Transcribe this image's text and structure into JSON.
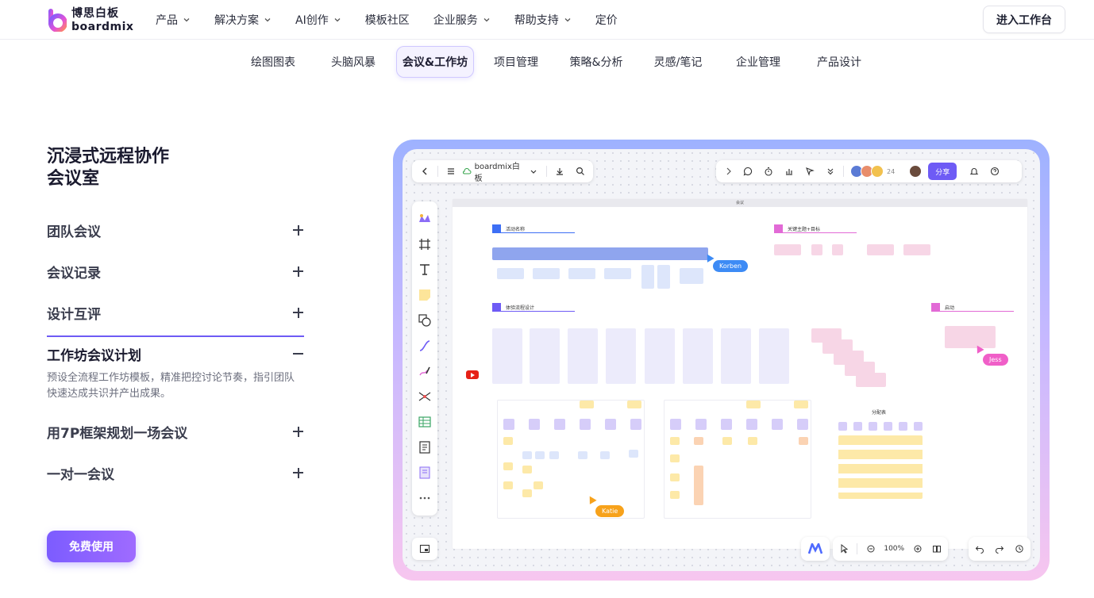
{
  "nav": {
    "logo_cn": "博思白板",
    "logo_en": "boardmix",
    "menu": [
      {
        "label": "产品",
        "has_dropdown": true
      },
      {
        "label": "解决方案",
        "has_dropdown": true
      },
      {
        "label": "AI创作",
        "has_dropdown": true
      },
      {
        "label": "模板社区",
        "has_dropdown": false
      },
      {
        "label": "企业服务",
        "has_dropdown": true
      },
      {
        "label": "帮助支持",
        "has_dropdown": true
      },
      {
        "label": "定价",
        "has_dropdown": false
      }
    ],
    "enter_button": "进入工作台"
  },
  "tabs": [
    {
      "label": "绘图图表",
      "active": false
    },
    {
      "label": "头脑风暴",
      "active": false
    },
    {
      "label": "会议&工作坊",
      "active": true
    },
    {
      "label": "项目管理",
      "active": false
    },
    {
      "label": "策略&分析",
      "active": false
    },
    {
      "label": "灵感/笔记",
      "active": false
    },
    {
      "label": "企业管理",
      "active": false
    },
    {
      "label": "产品设计",
      "active": false
    }
  ],
  "section": {
    "title_line1": "沉浸式远程协作",
    "title_line2": "会议室",
    "items": [
      {
        "label": "团队会议",
        "open": false
      },
      {
        "label": "会议记录",
        "open": false
      },
      {
        "label": "设计互评",
        "open": false
      },
      {
        "label": "工作坊会议计划",
        "open": true,
        "description": "预设全流程工作坊模板，精准把控讨论节奏，指引团队快速达成共识并产出成果。"
      },
      {
        "label": "用7P框架规划一场会议",
        "open": false
      },
      {
        "label": "一对一会议",
        "open": false
      }
    ],
    "cta": "免费使用"
  },
  "preview": {
    "file_name": "boardmix白板",
    "share_label": "分享",
    "collaborator_count": "24",
    "zoom": "100%",
    "board_title": "会议",
    "cursors": [
      {
        "name": "Korben",
        "color": "#3d8bf5"
      },
      {
        "name": "Jess",
        "color": "#f05fc8"
      },
      {
        "name": "Katie",
        "color": "#f7a21b"
      }
    ],
    "labels": {
      "activity_name": "活动名称",
      "key_topic": "关键主题+目标",
      "experience_design": "体验流程设计",
      "kickoff": "启动",
      "groups": "分配表"
    },
    "colors": {
      "accent": "#6e5bf5",
      "blue": "#3d6ff5",
      "pink": "#e26ad6"
    }
  }
}
